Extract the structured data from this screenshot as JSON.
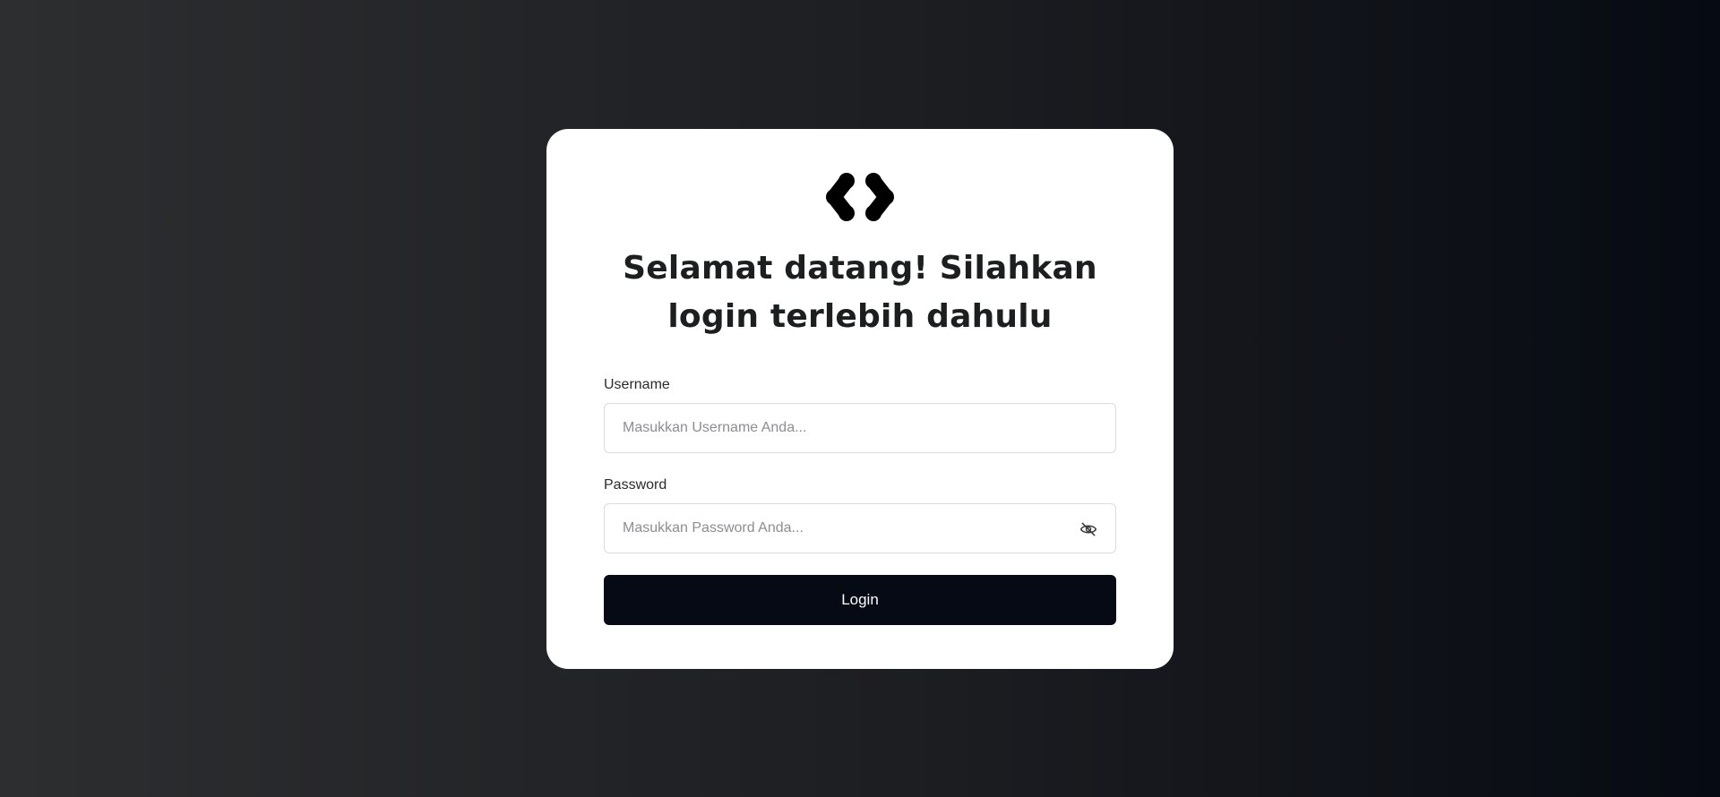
{
  "page": {
    "background_colors": [
      "#2d2e30",
      "#060a12"
    ]
  },
  "card": {
    "logo_icon": "four-dot-chevrons-logo-icon",
    "title": "Selamat datang! Silahkan login terlebih dahulu"
  },
  "form": {
    "username": {
      "label": "Username",
      "placeholder": "Masukkan Username Anda...",
      "value": ""
    },
    "password": {
      "label": "Password",
      "placeholder": "Masukkan Password Anda...",
      "value": "",
      "toggle_icon": "eye-off-icon"
    },
    "login_label": "Login"
  },
  "colors": {
    "card_bg": "#ffffff",
    "button_bg": "#060a14",
    "button_text": "#ffffff",
    "title_text": "#1d1e20"
  }
}
